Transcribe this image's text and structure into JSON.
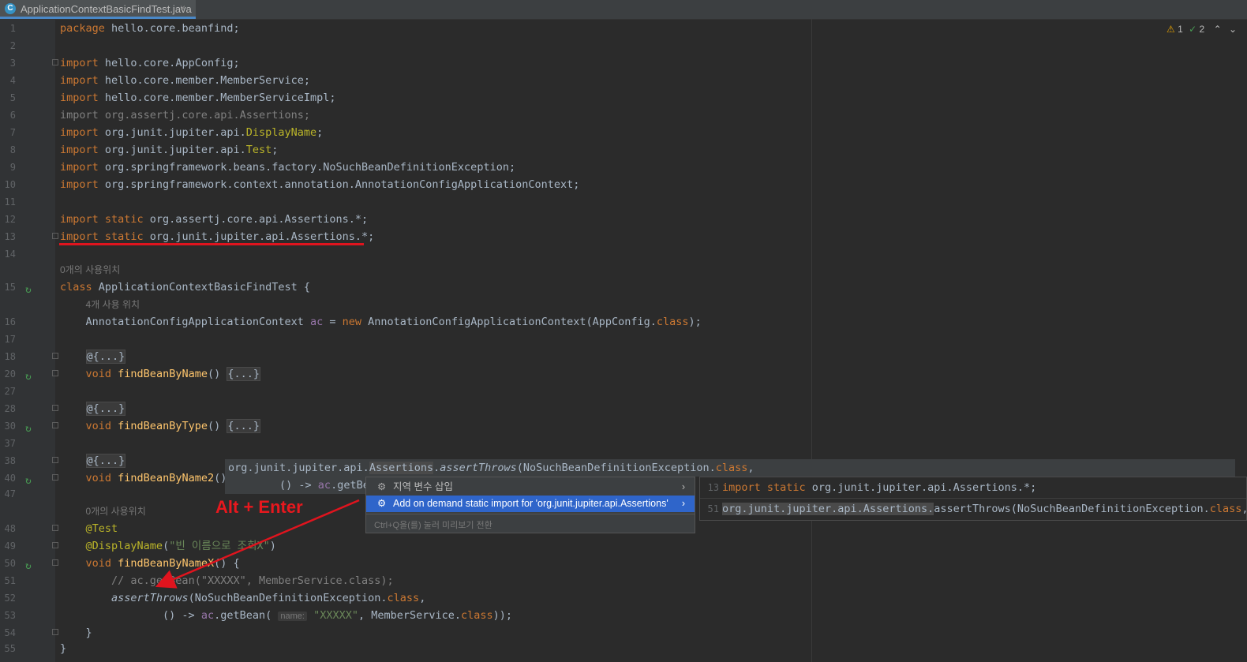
{
  "tab": {
    "filename": "ApplicationContextBasicFindTest.java",
    "icon": "java-class-icon",
    "close": "×"
  },
  "inspection": {
    "warnings": "1",
    "checks": "2"
  },
  "lines": [
    {
      "n": "1",
      "html": "<span class=\"kw\">package</span> hello.core.beanfind;"
    },
    {
      "n": "2",
      "html": ""
    },
    {
      "n": "3",
      "html": "<span class=\"kw\">import</span> hello.core.AppConfig;"
    },
    {
      "n": "4",
      "html": "<span class=\"kw\">import</span> hello.core.member.MemberService;"
    },
    {
      "n": "5",
      "html": "<span class=\"kw\">import</span> hello.core.member.MemberServiceImpl;"
    },
    {
      "n": "6",
      "html": "<span class=\"dim\">import org.assertj.core.api.Assertions;</span>"
    },
    {
      "n": "7",
      "html": "<span class=\"kw\">import</span> org.junit.jupiter.api.<span class=\"ann\">DisplayName</span>;"
    },
    {
      "n": "8",
      "html": "<span class=\"kw\">import</span> org.junit.jupiter.api.<span class=\"ann\">Test</span>;"
    },
    {
      "n": "9",
      "html": "<span class=\"kw\">import</span> org.springframework.beans.factory.NoSuchBeanDefinitionException;"
    },
    {
      "n": "10",
      "html": "<span class=\"kw\">import</span> org.springframework.context.annotation.AnnotationConfigApplicationContext;"
    },
    {
      "n": "11",
      "html": ""
    },
    {
      "n": "12",
      "html": "<span class=\"kw\">import static</span> org.assertj.core.api.Assertions.*;"
    },
    {
      "n": "13",
      "html": "<span class=\"kw\">import static</span> org.junit.jupiter.api.Assertions.*;"
    },
    {
      "n": "14",
      "html": ""
    },
    {
      "n": "",
      "html": "<span class=\"hint\">0개의 사용위치</span>"
    },
    {
      "n": "15",
      "html": "<span class=\"kw\">class</span> ApplicationContextBasicFindTest {"
    },
    {
      "n": "",
      "html": "    <span class=\"hint\">4개 사용 위치</span>"
    },
    {
      "n": "16",
      "html": "    AnnotationConfigApplicationContext <span class=\"fld\">ac</span> = <span class=\"kw\">new</span> AnnotationConfigApplicationContext(AppConfig.<span class=\"kw\">class</span>);"
    },
    {
      "n": "17",
      "html": ""
    },
    {
      "n": "18",
      "html": "    <span class=\"fcol\">@{...}</span>"
    },
    {
      "n": "20",
      "html": "    <span class=\"kw\">void</span> <span class=\"fn\">findBeanByName</span>() <span class=\"fcol\">{...}</span>"
    },
    {
      "n": "27",
      "html": ""
    },
    {
      "n": "28",
      "html": "    <span class=\"fcol\">@{...}</span>"
    },
    {
      "n": "30",
      "html": "    <span class=\"kw\">void</span> <span class=\"fn\">findBeanByType</span>() <span class=\"fcol\">{...}</span>"
    },
    {
      "n": "37",
      "html": ""
    },
    {
      "n": "38",
      "html": "    <span class=\"fcol\">@{...}</span>"
    },
    {
      "n": "40",
      "html": "    <span class=\"kw\">void</span> <span class=\"fn\">findBeanByName2</span>()"
    },
    {
      "n": "47",
      "html": ""
    },
    {
      "n": "",
      "html": "    <span class=\"hint\">0개의 사용위치</span>"
    },
    {
      "n": "48",
      "html": "    <span class=\"ann\">@Test</span>"
    },
    {
      "n": "49",
      "html": "    <span class=\"ann\">@DisplayName</span>(<span class=\"str\">\"빈 이름으로 조회X\"</span>)"
    },
    {
      "n": "50",
      "html": "    <span class=\"kw\">void</span> <span class=\"fn\">findBeanByNameX</span>() {"
    },
    {
      "n": "51",
      "html": "        <span class=\"cm\">// ac.getBean(\"XXXXX\", MemberService.class);</span>"
    },
    {
      "n": "52",
      "html": "        <span class=\"it\">assertThrows</span>(NoSuchBeanDefinitionException.<span class=\"kw\">class</span>,"
    },
    {
      "n": "53",
      "html": "                () -&gt; <span class=\"fld\">ac</span>.getBean( <span class=\"pinlabel\">name:</span> <span class=\"str\">\"XXXXX\"</span>, MemberService.<span class=\"kw\">class</span>));"
    },
    {
      "n": "54",
      "html": "    }"
    },
    {
      "n": "55",
      "html": "}"
    }
  ],
  "tooltip": {
    "line1": "org.junit.jupiter.api.<span class=\"hlbox\">Assertions</span>.<span class=\"it\">assertThrows</span>(NoSuchBeanDefinitionException.<span class=\"kw\">class</span>,",
    "line2": "        () -&gt; <span class=\"fld\">ac</span>.getBe"
  },
  "annotation": {
    "shortcut": "Alt + Enter"
  },
  "popup": {
    "items": [
      {
        "label": "지역 변수 삽입",
        "arrow": "›"
      },
      {
        "label": "Add on demand static import for 'org.junit.jupiter.api.Assertions'",
        "arrow": "›"
      }
    ],
    "footer": "Ctrl+Q을(를) 눌러 미리보기 전환"
  },
  "preview": {
    "rows": [
      {
        "n": "13",
        "html": "<span class=\"kw\">import static</span> org.junit.jupiter.api.Assertions.*;"
      },
      {
        "n": "51",
        "html": "<span class=\"hlbox\">org.junit.jupiter.api.Assertions.</span>assertThrows(NoSuchBeanDefinitionException.<span class=\"kw\">class</span>,"
      }
    ]
  }
}
